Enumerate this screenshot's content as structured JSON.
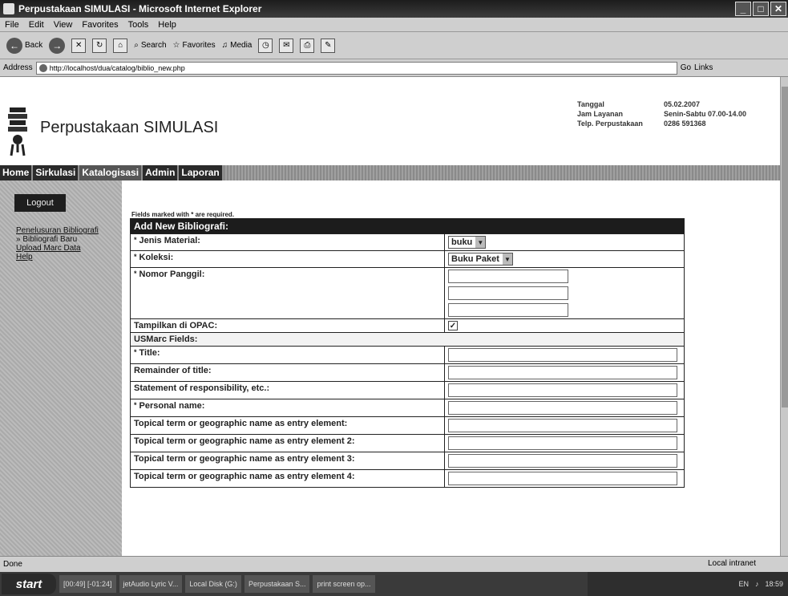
{
  "window": {
    "title": "Perpustakaan SIMULASI - Microsoft Internet Explorer"
  },
  "menu": [
    "File",
    "Edit",
    "View",
    "Favorites",
    "Tools",
    "Help"
  ],
  "toolbar": {
    "back": "Back",
    "search": "Search",
    "favorites": "Favorites",
    "media": "Media"
  },
  "address": {
    "label": "Address",
    "url": "http://localhost/dua/catalog/biblio_new.php",
    "go": "Go",
    "links": "Links"
  },
  "site": {
    "title": "Perpustakaan SIMULASI",
    "info": [
      {
        "key": "Tanggal",
        "value": "05.02.2007"
      },
      {
        "key": "Jam Layanan",
        "value": "Senin-Sabtu 07.00-14.00"
      },
      {
        "key": "Telp. Perpustakaan",
        "value": "0286 591368"
      }
    ]
  },
  "nav": {
    "tabs": [
      "Home",
      "Sirkulasi",
      "Katalogisasi",
      "Admin",
      "Laporan"
    ],
    "active": "Katalogisasi"
  },
  "sidebar": {
    "logout": "Logout",
    "links": [
      "Penelusuran Bibliografi",
      "» Bibliografi Baru",
      "Upload Marc Data",
      "Help"
    ]
  },
  "form": {
    "note": "Fields marked with * are required.",
    "header": "Add New Bibliografi:",
    "jenis_material": {
      "label": "Jenis Material:",
      "value": "buku"
    },
    "koleksi": {
      "label": "Koleksi:",
      "value": "Buku Paket"
    },
    "nomor_panggil": {
      "label": "Nomor Panggil:"
    },
    "opac": {
      "label": "Tampilkan di OPAC:",
      "checked": true
    },
    "usmarc_header": "USMarc Fields:",
    "fields": [
      {
        "label": "Title:",
        "required": true
      },
      {
        "label": "Remainder of title:",
        "required": false
      },
      {
        "label": "Statement of responsibility, etc.:",
        "required": false
      },
      {
        "label": "Personal name:",
        "required": true
      },
      {
        "label": "Topical term or geographic name as entry element:",
        "required": false
      },
      {
        "label": "Topical term or geographic name as entry element 2:",
        "required": false
      },
      {
        "label": "Topical term or geographic name as entry element 3:",
        "required": false
      },
      {
        "label": "Topical term or geographic name as entry element 4:",
        "required": false
      }
    ]
  },
  "status": {
    "left": "Done",
    "right": "Local intranet"
  },
  "taskbar": {
    "start": "start",
    "tasks": [
      "[00:49] [-01:24]",
      "jetAudio Lyric V...",
      "Local Disk (G:)",
      "Perpustakaan S...",
      "print screen op..."
    ],
    "tray": {
      "lang": "EN",
      "time": "18:59"
    }
  }
}
